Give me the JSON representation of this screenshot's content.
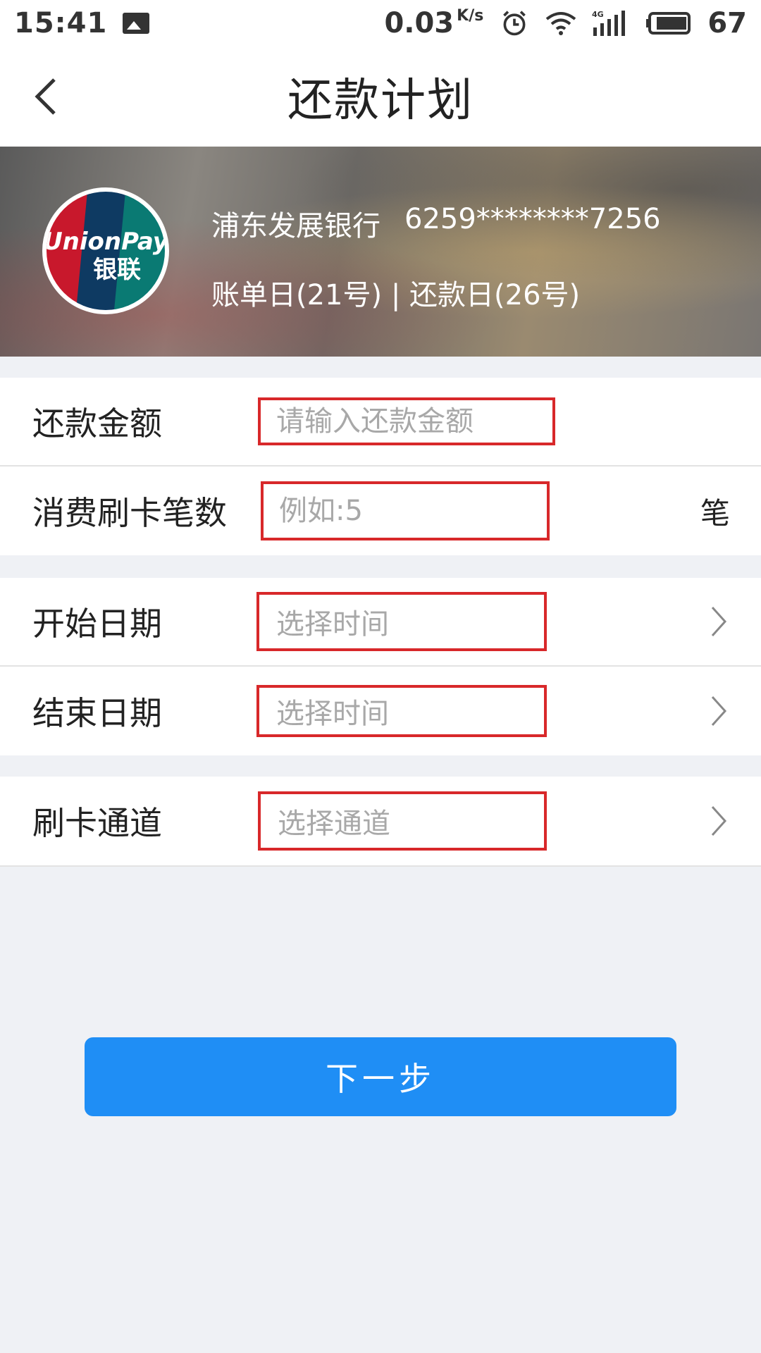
{
  "status_bar": {
    "time": "15:41",
    "speed": "0.03",
    "speed_unit": "K/s",
    "battery": "67"
  },
  "header": {
    "title": "还款计划"
  },
  "card": {
    "bank_name": "浦东发展银行",
    "card_number": "6259********7256",
    "dates": "账单日(21号) | 还款日(26号)",
    "logo_text_top": "UnionPay",
    "logo_text_bottom": "银联"
  },
  "form": {
    "amount": {
      "label": "还款金额",
      "placeholder": "请输入还款金额"
    },
    "count": {
      "label": "消费刷卡笔数",
      "placeholder": "例如:5",
      "unit": "笔"
    },
    "start_date": {
      "label": "开始日期",
      "placeholder": "选择时间"
    },
    "end_date": {
      "label": "结束日期",
      "placeholder": "选择时间"
    },
    "channel": {
      "label": "刷卡通道",
      "placeholder": "选择通道"
    }
  },
  "actions": {
    "next_label": "下一步"
  },
  "colors": {
    "accent": "#1f8ef5",
    "highlight_border": "#d8282a",
    "background": "#eff1f5"
  }
}
